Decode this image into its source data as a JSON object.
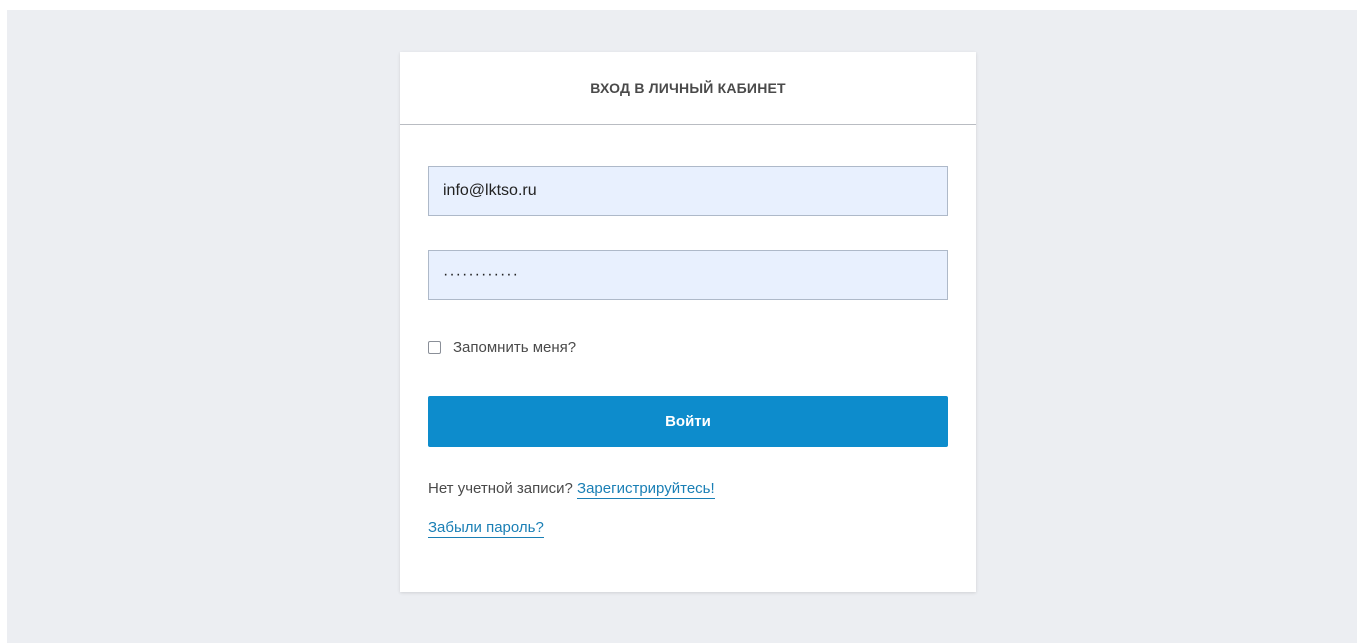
{
  "login": {
    "title": "ВХОД В ЛИЧНЫЙ КАБИНЕТ",
    "email_value": "info@lktso.ru",
    "password_value": "············",
    "remember_label": "Запомнить меня?",
    "remember_checked": false,
    "submit_label": "Войти",
    "no_account_text": "Нет учетной записи?",
    "register_link": "Зарегистрируйтесь!",
    "forgot_link": "Забыли пароль?"
  },
  "colors": {
    "page_background": "#eceef2",
    "input_background": "#e8f0fe",
    "button_primary": "#0d8ccc",
    "link": "#1a7fb5"
  }
}
